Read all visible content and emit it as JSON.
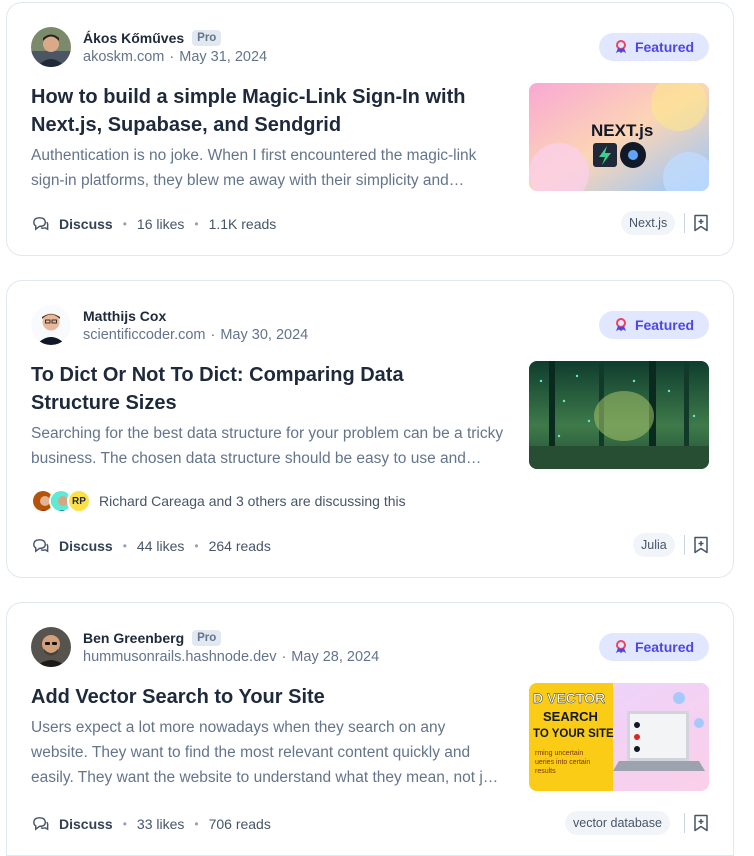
{
  "posts": [
    {
      "author": "Ákos Kőműves",
      "badge": "Pro",
      "domain": "akoskm.com",
      "sep": "·",
      "date": "May 31, 2024",
      "featured": "Featured",
      "title": "How to build a simple Magic-Link Sign-In with Next.js, Supabase, and Sendgrid",
      "excerpt": "Authentication is no joke. When I first encountered the magic-link sign-in platforms, they blew me away with their simplicity and elegance.",
      "discuss": "Discuss",
      "likes": "16 likes",
      "reads": "1.1K reads",
      "tag": "Next.js",
      "thumb_text": "NEXT.js"
    },
    {
      "author": "Matthijs Cox",
      "badge": "",
      "domain": "scientificcoder.com",
      "sep": "·",
      "date": "May 30, 2024",
      "featured": "Featured",
      "title": "To Dict Or Not To Dict: Comparing Data Structure Sizes",
      "excerpt": "Searching for the best data structure for your problem can be a tricky business. The chosen data structure should be easy to use and efficient.",
      "discussing": "Richard Careaga and 3 others are discussing this",
      "discussing_initials": "RP",
      "discuss": "Discuss",
      "likes": "44 likes",
      "reads": "264 reads",
      "tag": "Julia"
    },
    {
      "author": "Ben Greenberg",
      "badge": "Pro",
      "domain": "hummusonrails.hashnode.dev",
      "sep": "·",
      "date": "May 28, 2024",
      "featured": "Featured",
      "title": "Add Vector Search to Your Site",
      "excerpt": "Users expect a lot more nowadays when they search on any website. They want to find the most relevant content quickly and easily. They want the website to understand what they mean, not just what they type.",
      "discuss": "Discuss",
      "likes": "33 likes",
      "reads": "706 reads",
      "tag": "vector database",
      "thumb_text": "D VECTOR SEARCH TO YOUR SITE"
    }
  ],
  "colors": {
    "featured_bg": "#e0e7ff",
    "featured_text": "#4f46e5",
    "title": "#1e293b",
    "muted": "#64748b",
    "border": "#e2e8f0"
  }
}
